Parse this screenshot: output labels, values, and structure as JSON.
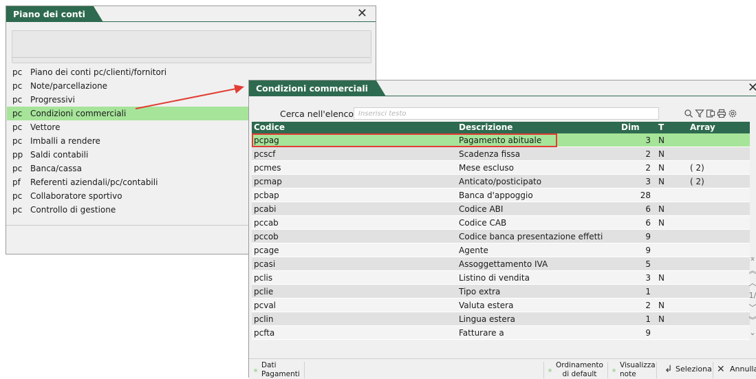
{
  "back_window": {
    "title": "Piano dei conti",
    "menu": [
      {
        "code": "pc",
        "label": "Piano dei conti pc/clienti/fornitori"
      },
      {
        "code": "pc",
        "label": "Note/parcellazione"
      },
      {
        "code": "pc",
        "label": "Progressivi"
      },
      {
        "code": "pc",
        "label": "Condizioni commerciali",
        "selected": true
      },
      {
        "code": "pc",
        "label": "Vettore"
      },
      {
        "code": "pc",
        "label": "Imballi a rendere"
      },
      {
        "code": "pp",
        "label": "Saldi contabili"
      },
      {
        "code": "pc",
        "label": "Banca/cassa"
      },
      {
        "code": "pf",
        "label": "Referenti aziendali/pc/contabili"
      },
      {
        "code": "pc",
        "label": "Collaboratore sportivo"
      },
      {
        "code": "pc",
        "label": "Controllo di gestione"
      }
    ]
  },
  "front_window": {
    "title": "Condizioni commerciali",
    "search": {
      "label": "Cerca nell'elenco",
      "placeholder": "Inserisci testo"
    },
    "columns": {
      "code": "Codice",
      "desc": "Descrizione",
      "dim": "Dim",
      "type": "T",
      "array": "Array"
    },
    "rows": [
      {
        "code": "pcpag",
        "desc": "Pagamento abituale",
        "dim": "3",
        "type": "N",
        "array": "",
        "selected": true
      },
      {
        "code": "pcscf",
        "desc": "Scadenza fissa",
        "dim": "2",
        "type": "N",
        "array": ""
      },
      {
        "code": "pcmes",
        "desc": "Mese escluso",
        "dim": "2",
        "type": "N",
        "array": "( 2)"
      },
      {
        "code": "pcmap",
        "desc": "Anticato/posticipato",
        "dim": "3",
        "type": "N",
        "array": "( 2)"
      },
      {
        "code": "pcbap",
        "desc": "Banca d'appoggio",
        "dim": "28",
        "type": "",
        "array": ""
      },
      {
        "code": "pcabi",
        "desc": "Codice ABI",
        "dim": "6",
        "type": "N",
        "array": ""
      },
      {
        "code": "pccab",
        "desc": "Codice CAB",
        "dim": "6",
        "type": "N",
        "array": ""
      },
      {
        "code": "pccob",
        "desc": "Codice banca presentazione effetti",
        "dim": "9",
        "type": "",
        "array": ""
      },
      {
        "code": "pcage",
        "desc": "Agente",
        "dim": "9",
        "type": "",
        "array": ""
      },
      {
        "code": "pcasi",
        "desc": "Assoggettamento IVA",
        "dim": "5",
        "type": "",
        "array": ""
      },
      {
        "code": "pclis",
        "desc": "Listino di vendita",
        "dim": "3",
        "type": "N",
        "array": ""
      },
      {
        "code": "pclie",
        "desc": "Tipo extra",
        "dim": "1",
        "type": "",
        "array": ""
      },
      {
        "code": "pcval",
        "desc": "Valuta estera",
        "dim": "2",
        "type": "N",
        "array": ""
      },
      {
        "code": "pclin",
        "desc": "Lingua estera",
        "dim": "1",
        "type": "N",
        "array": ""
      },
      {
        "code": "pcfta",
        "desc": "Fatturare a",
        "dim": "9",
        "type": "",
        "array": ""
      }
    ],
    "page_indicator": "1/",
    "footer": {
      "dati_pagamenti": [
        "Dati",
        "Pagamenti"
      ],
      "ordinamento": [
        "Ordinamento",
        "di default"
      ],
      "visualizza": [
        "Visualizza",
        "note"
      ],
      "seleziona": "Seleziona",
      "annulla": "Annulla"
    }
  },
  "colors": {
    "title_bar": "#2e6a4f",
    "selection": "#a6e49a",
    "highlight_box": "#e23c33",
    "arrow": "#e23c33"
  }
}
